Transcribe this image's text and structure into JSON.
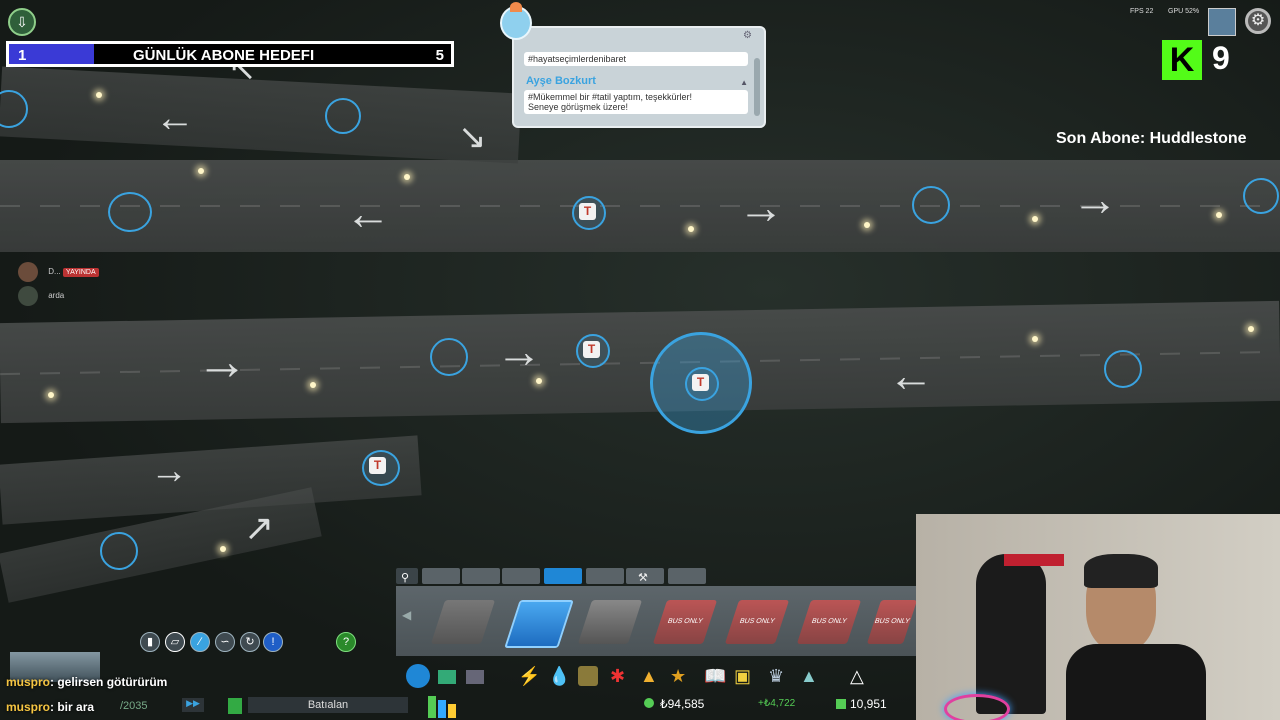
{
  "goal": {
    "start": "1",
    "title": "GÜNLÜK ABONE HEDEFI",
    "end": "5",
    "progress_fraction": 0.2
  },
  "chirper": {
    "message_1": "#hayatseçimlerdenibaret",
    "author_2": "Ayşe Bozkurt",
    "message_2_line1": "#Mükemmel bir #tatil yaptım, teşekkürler!",
    "message_2_line2": "Seneye görüşmek üzere!"
  },
  "stats": {
    "fps": "FPS 22",
    "gpu": "GPU 52%"
  },
  "kick": {
    "logo": "K",
    "count": "9"
  },
  "last_sub": "Son Abone: Huddlestone",
  "viewers": [
    {
      "name": "D...",
      "badge": "YAYINDA"
    },
    {
      "name": "arda",
      "badge": ""
    }
  ],
  "map": {
    "service_marker": "T"
  },
  "toolbar": {
    "road_tile_labels": [
      "BUS ONLY",
      "BUS ONLY",
      "BUS ONLY",
      "BUS ONLY"
    ]
  },
  "status": {
    "date": "/2035",
    "district": "Batıalan",
    "money": "₺94,585",
    "income": "+₺4,722",
    "population": "10,951"
  },
  "chat": [
    {
      "user": "muspro",
      "text": ": gelirsen götürürüm"
    },
    {
      "user": "muspro",
      "text": ": bir ara"
    }
  ],
  "colors": {
    "accent": "#3aa3e0",
    "goal_fill": "#3a3ad6",
    "kick": "#53fc18"
  },
  "icons": [
    "search-icon",
    "electricity-icon",
    "water-icon",
    "garbage-icon",
    "health-icon",
    "fire-icon",
    "police-icon",
    "education-icon",
    "transport-icon",
    "park-icon",
    "monument-icon",
    "help-icon",
    "gear-icon"
  ]
}
